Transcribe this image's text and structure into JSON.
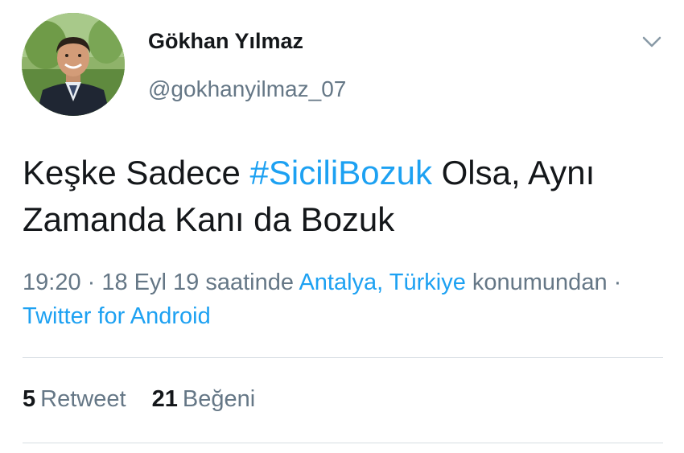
{
  "user": {
    "display_name": "Gökhan Yılmaz",
    "handle": "@gokhanyilmaz_07"
  },
  "tweet": {
    "text_before": "Keşke Sadece ",
    "hashtag": "#SiciliBozuk",
    "text_after": " Olsa, Aynı Zamanda Kanı da Bozuk"
  },
  "meta": {
    "time": "19:20",
    "separator1": " · ",
    "date_text": "18 Eyl 19 saatinde ",
    "location": "Antalya, Türkiye",
    "location_suffix": " konumundan",
    "separator2": " · ",
    "source": "Twitter for Android"
  },
  "stats": {
    "retweets_count": "5",
    "retweets_label": "Retweet",
    "likes_count": "21",
    "likes_label": "Beğeni"
  },
  "icons": {
    "caret": "chevron-down-icon",
    "avatar": "profile-photo"
  },
  "colors": {
    "link": "#1da1f2",
    "secondary_text": "#657786",
    "primary_text": "#14171a",
    "divider": "#d6dde3"
  }
}
